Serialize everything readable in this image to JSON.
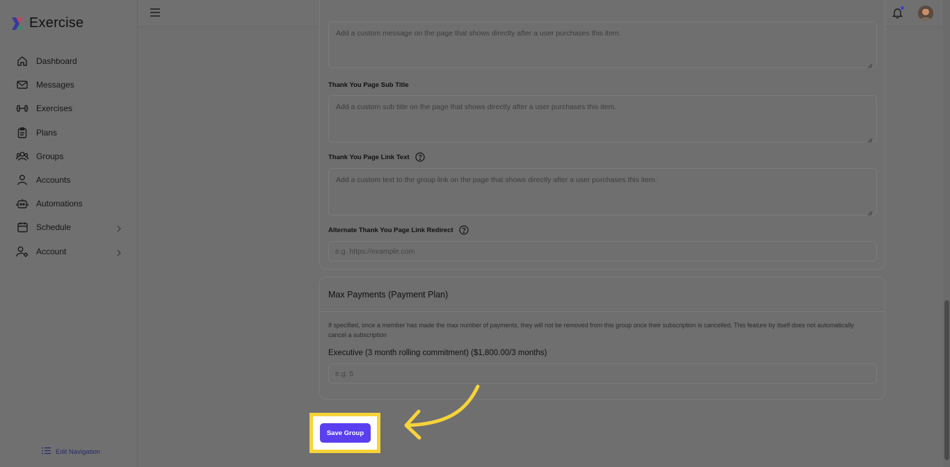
{
  "app": {
    "name": "Exercise"
  },
  "sidebar": {
    "items": [
      {
        "label": "Dashboard",
        "icon": "home-icon"
      },
      {
        "label": "Messages",
        "icon": "mail-icon"
      },
      {
        "label": "Exercises",
        "icon": "dumbbell-icon"
      },
      {
        "label": "Plans",
        "icon": "clipboard-icon"
      },
      {
        "label": "Groups",
        "icon": "users-icon"
      },
      {
        "label": "Accounts",
        "icon": "user-icon"
      },
      {
        "label": "Automations",
        "icon": "robot-icon"
      },
      {
        "label": "Schedule",
        "icon": "calendar-icon",
        "has_children": true
      },
      {
        "label": "Account",
        "icon": "user-gear-icon",
        "has_children": true
      }
    ],
    "edit_navigation": "Edit Navigation"
  },
  "form": {
    "thankyou_message_placeholder": "Add a custom message on the page that shows directly after a user purchases this item.",
    "subtitle_label": "Thank You Page Sub Title",
    "subtitle_placeholder": "Add a custom sub title on the page that shows directly after a user purchases this item.",
    "link_text_label": "Thank You Page Link Text",
    "link_text_placeholder": "Add a custom text to the group link on the page that shows directly after a user purchases this item.",
    "redirect_label": "Alternate Thank You Page Link Redirect",
    "redirect_placeholder": "e.g. https://example.com"
  },
  "max_payments": {
    "title": "Max Payments (Payment Plan)",
    "description": "If specified, once a member has made the max number of payments, they will not be removed from this group once their subscription is cancelled. This feature by itself does not automatically cancel a subscription",
    "plan_label": "Executive (3 month rolling commitment) ($1,800.00/3 months)",
    "input_placeholder": "e.g. 5"
  },
  "actions": {
    "save_label": "Save Group"
  },
  "colors": {
    "accent": "#5a3ff0",
    "highlight": "#f7d33a",
    "notification_dot": "#3b3fd6"
  }
}
